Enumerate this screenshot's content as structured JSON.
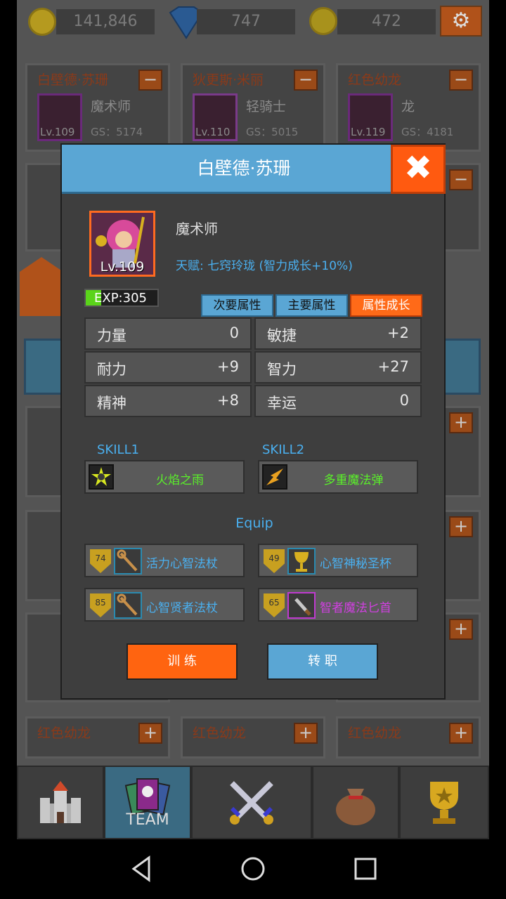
{
  "resources": {
    "gold": "141,846",
    "gems": "747",
    "stars": "472"
  },
  "colors": {
    "accent_orange": "#ff6a18",
    "accent_blue": "#5aa6d4",
    "skill_green": "#5af02a",
    "equip_blue": "#4ab0f0",
    "equip_purple": "#d040e0"
  },
  "background_cards": [
    {
      "name": "白壁德·苏珊",
      "class": "魔术师",
      "level": "Lv.109",
      "gs": "GS：5174",
      "action": "−"
    },
    {
      "name": "狄更斯·米丽",
      "class": "轻骑士",
      "level": "Lv.110",
      "gs": "GS：5015",
      "action": "−"
    },
    {
      "name": "红色幼龙",
      "class": "龙",
      "level": "Lv.119",
      "gs": "GS：4181",
      "action": "−"
    }
  ],
  "bottom_cards": [
    {
      "name": "红色幼龙",
      "action": "+"
    },
    {
      "name": "红色幼龙",
      "action": "+"
    },
    {
      "name": "红色幼龙",
      "action": "+"
    }
  ],
  "modal": {
    "title": "白壁德·苏珊",
    "close_icon": "close-icon",
    "hero_level": "Lv.109",
    "hero_class": "魔术师",
    "talent": "天赋: 七窍玲珑 (智力成长+10%)",
    "exp_text": "EXP:305",
    "exp_fraction": 0.22,
    "attr_tabs": [
      "次要属性",
      "主要属性",
      "属性成长"
    ],
    "active_attr_tab": 2,
    "stats": [
      {
        "label": "力量",
        "value": "0",
        "dim": true
      },
      {
        "label": "敏捷",
        "value": "+2",
        "dim": false
      },
      {
        "label": "耐力",
        "value": "+9",
        "dim": false
      },
      {
        "label": "智力",
        "value": "+27",
        "dim": false
      },
      {
        "label": "精神",
        "value": "+8",
        "dim": false
      },
      {
        "label": "幸运",
        "value": "0",
        "dim": true
      }
    ],
    "skills": [
      {
        "label": "SKILL1",
        "name": "火焰之雨"
      },
      {
        "label": "SKILL2",
        "name": "多重魔法弹"
      }
    ],
    "equip_label": "Equip",
    "equips": [
      {
        "level": "74",
        "name": "活力心智法杖",
        "rarity": "blue"
      },
      {
        "level": "49",
        "name": "心智神秘圣杯",
        "rarity": "blue"
      },
      {
        "level": "85",
        "name": "心智贤者法杖",
        "rarity": "blue"
      },
      {
        "level": "65",
        "name": "智者魔法匕首",
        "rarity": "purple"
      }
    ],
    "train_button": "训 练",
    "transfer_button": "转 职"
  },
  "tabs": [
    {
      "name": "castle",
      "icon": "castle-icon",
      "label": ""
    },
    {
      "name": "team",
      "icon": "team-card-icon",
      "label": "TEAM"
    },
    {
      "name": "battle",
      "icon": "crossed-swords-icon",
      "label": ""
    },
    {
      "name": "bag",
      "icon": "money-bag-icon",
      "label": ""
    },
    {
      "name": "trophy",
      "icon": "trophy-icon",
      "label": ""
    }
  ]
}
